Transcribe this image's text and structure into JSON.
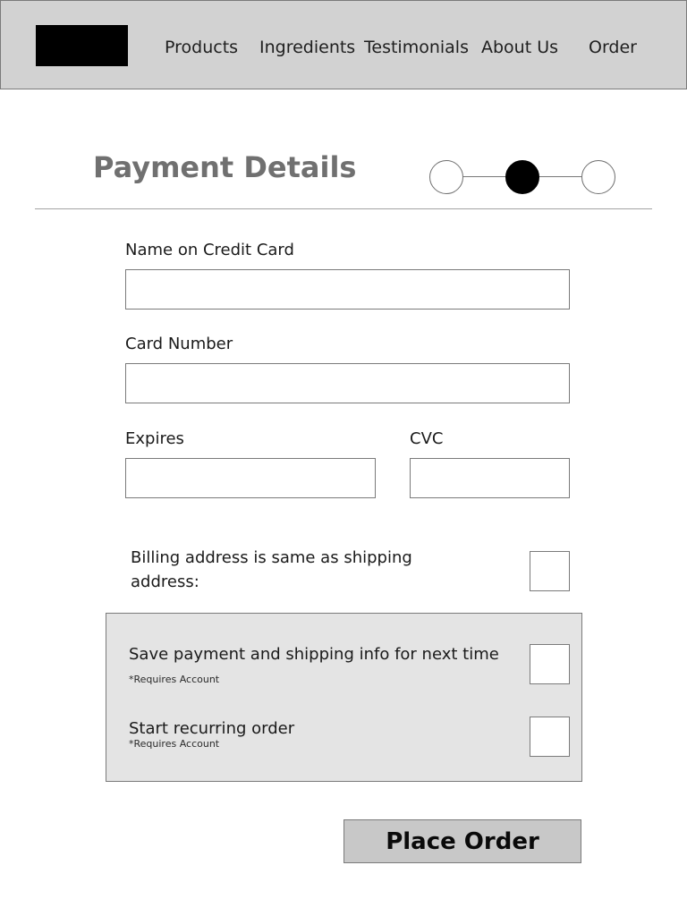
{
  "header": {
    "nav": [
      "Products",
      "Ingredients",
      "Testimonials",
      "About Us",
      "Order"
    ]
  },
  "page": {
    "title": "Payment Details"
  },
  "stepper": {
    "total_steps": 3,
    "current_step": 2
  },
  "form": {
    "name_on_card": {
      "label": "Name on Credit Card",
      "value": ""
    },
    "card_number": {
      "label": "Card Number",
      "value": ""
    },
    "expires": {
      "label": "Expires",
      "value": ""
    },
    "cvc": {
      "label": "CVC",
      "value": ""
    },
    "billing_same": {
      "label": "Billing address is same as shipping address:",
      "checked": false
    }
  },
  "options": {
    "save_info": {
      "label": "Save payment and shipping info for next time",
      "note": "*Requires Account",
      "checked": false
    },
    "recurring": {
      "label": "Start recurring order",
      "note": "*Requires Account",
      "checked": false
    }
  },
  "actions": {
    "place_order": "Place Order"
  },
  "colors": {
    "header_bg": "#d2d2d2",
    "options_bg": "#e4e4e4",
    "button_bg": "#c8c8c8",
    "active_step": "#000000"
  }
}
